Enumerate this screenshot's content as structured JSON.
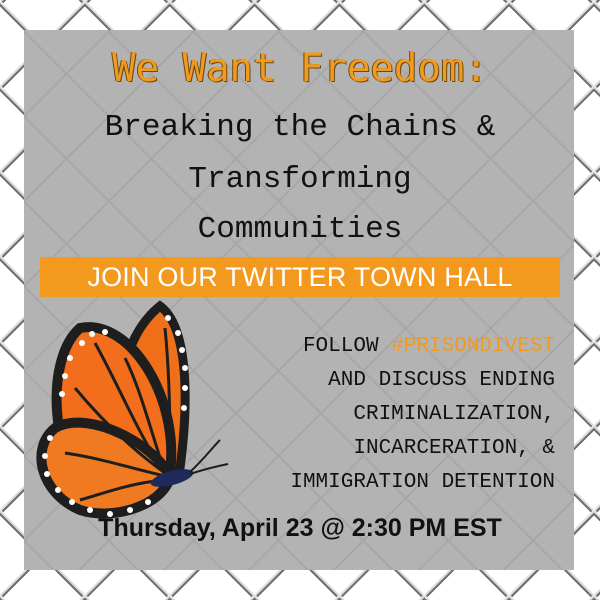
{
  "poster": {
    "title": "We Want Freedom:",
    "subtitle_lines": [
      "Breaking the Chains &",
      "Transforming",
      "Communities"
    ],
    "banner": "JOIN OUR TWITTER TOWN HALL",
    "follow_prefix": "FOLLOW ",
    "hashtag": "#PRISONDIVEST",
    "body_lines": [
      "AND DISCUSS ENDING",
      "CRIMINALIZATION,",
      "INCARCERATION, &",
      "IMMIGRATION DETENTION"
    ],
    "date": "Thursday, April 23 @ 2:30 PM EST"
  },
  "colors": {
    "accent_orange": "#f39a1e",
    "panel_gray": "#b3b3b3",
    "text_dark": "#111111",
    "butterfly_orange": "#f0701a",
    "butterfly_border": "#1e1e1e"
  },
  "icons": [
    "chain-link-fence-background",
    "monarch-butterfly-icon"
  ]
}
